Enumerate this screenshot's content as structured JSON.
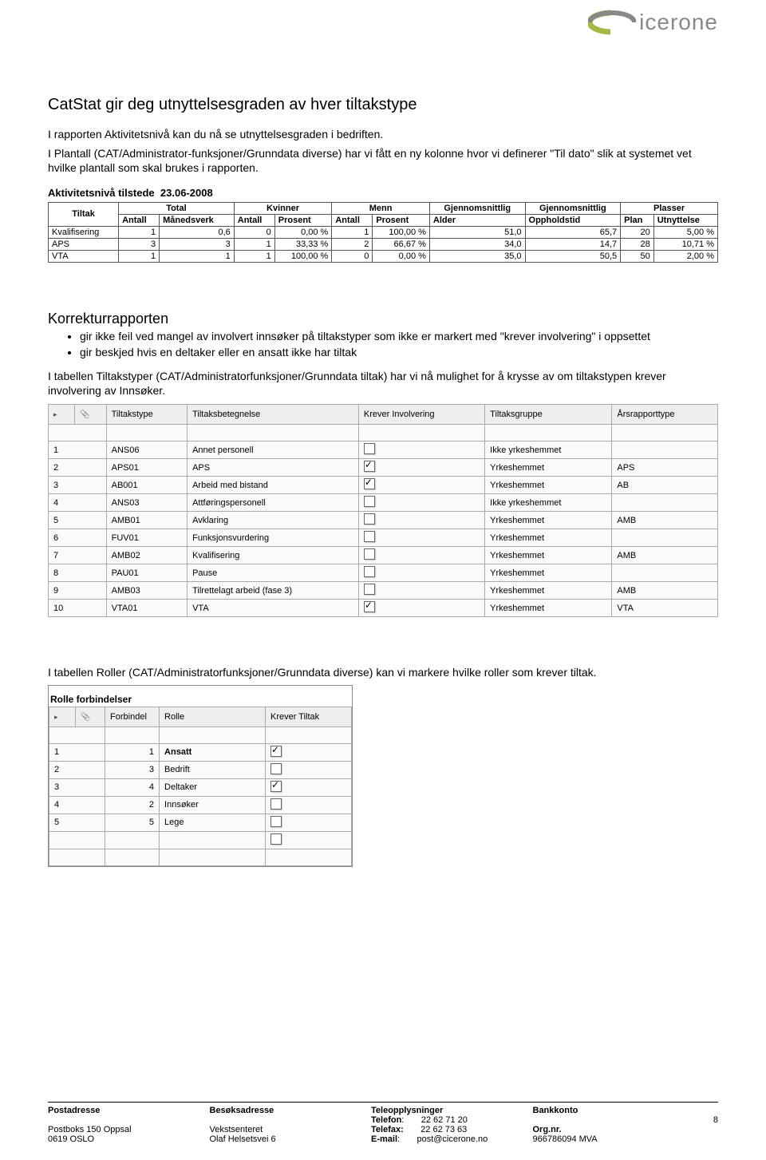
{
  "logo": {
    "text": "icerone"
  },
  "title": "CatStat gir deg utnyttelsesgraden av hver tiltakstype",
  "intro1": "I rapporten Aktivitetsnivå kan du nå se utnyttelsesgraden i bedriften.",
  "intro2": "I Plantall (CAT/Administrator-funksjoner/Grunndata diverse) har vi fått en ny kolonne hvor vi definerer \"Til dato\" slik at systemet vet hvilke plantall som skal brukes i rapporten.",
  "stats_header_label": "Aktivitetsnivå tilstede",
  "stats_header_date": "23.06-2008",
  "stats_groups": [
    "Total",
    "Kvinner",
    "Menn",
    "Gjennomsnittlig",
    "Gjennomsnittlig",
    "Plasser"
  ],
  "stats_subs": [
    "Tiltak",
    "Antall",
    "Månedsverk",
    "Antall",
    "Prosent",
    "Antall",
    "Prosent",
    "Alder",
    "Oppholdstid",
    "Plan",
    "Utnyttelse"
  ],
  "stats_rows": [
    {
      "tiltak": "Kvalifisering",
      "antall": "1",
      "mnd": "0,6",
      "kant": "0",
      "kpros": "0,00 %",
      "mant": "1",
      "mpros": "100,00 %",
      "alder": "51,0",
      "opp": "65,7",
      "plan": "20",
      "utny": "5,00 %"
    },
    {
      "tiltak": "APS",
      "antall": "3",
      "mnd": "3",
      "kant": "1",
      "kpros": "33,33 %",
      "mant": "2",
      "mpros": "66,67 %",
      "alder": "34,0",
      "opp": "14,7",
      "plan": "28",
      "utny": "10,71 %"
    },
    {
      "tiltak": "VTA",
      "antall": "1",
      "mnd": "1",
      "kant": "1",
      "kpros": "100,00 %",
      "mant": "0",
      "mpros": "0,00 %",
      "alder": "35,0",
      "opp": "50,5",
      "plan": "50",
      "utny": "2,00 %"
    }
  ],
  "korr_head": "Korrekturrapporten",
  "korr_bullets": [
    "gir ikke feil ved mangel av involvert innsøker på tiltakstyper som ikke er markert med \"krever involvering\" i oppsettet",
    "gir beskjed hvis en deltaker eller en ansatt ikke har tiltak"
  ],
  "korr_para": "I tabellen Tiltakstyper (CAT/Administratorfunksjoner/Grunndata tiltak) har vi nå mulighet for å krysse av om tiltakstypen krever involvering av Innsøker.",
  "tiltak_headers": [
    "",
    "Tiltakstype",
    "Tiltaksbetegnelse",
    "Krever Involvering",
    "Tiltaksgruppe",
    "Årsrapporttype"
  ],
  "tiltak_rows": [
    {
      "n": "1",
      "type": "ANS06",
      "bet": "Annet personell",
      "inv": false,
      "gruppe": "Ikke yrkeshemmet",
      "rapp": ""
    },
    {
      "n": "2",
      "type": "APS01",
      "bet": "APS",
      "inv": true,
      "gruppe": "Yrkeshemmet",
      "rapp": "APS"
    },
    {
      "n": "3",
      "type": "AB001",
      "bet": "Arbeid med bistand",
      "inv": true,
      "gruppe": "Yrkeshemmet",
      "rapp": "AB"
    },
    {
      "n": "4",
      "type": "ANS03",
      "bet": "Attføringspersonell",
      "inv": false,
      "gruppe": "Ikke yrkeshemmet",
      "rapp": ""
    },
    {
      "n": "5",
      "type": "AMB01",
      "bet": "Avklaring",
      "inv": false,
      "gruppe": "Yrkeshemmet",
      "rapp": "AMB"
    },
    {
      "n": "6",
      "type": "FUV01",
      "bet": "Funksjonsvurdering",
      "inv": false,
      "gruppe": "Yrkeshemmet",
      "rapp": ""
    },
    {
      "n": "7",
      "type": "AMB02",
      "bet": "Kvalifisering",
      "inv": false,
      "gruppe": "Yrkeshemmet",
      "rapp": "AMB"
    },
    {
      "n": "8",
      "type": "PAU01",
      "bet": "Pause",
      "inv": false,
      "gruppe": "Yrkeshemmet",
      "rapp": ""
    },
    {
      "n": "9",
      "type": "AMB03",
      "bet": "Tilrettelagt arbeid (fase 3)",
      "inv": false,
      "gruppe": "Yrkeshemmet",
      "rapp": "AMB"
    },
    {
      "n": "10",
      "type": "VTA01",
      "bet": "VTA",
      "inv": true,
      "gruppe": "Yrkeshemmet",
      "rapp": "VTA"
    }
  ],
  "roller_para": "I tabellen Roller (CAT/Administratorfunksjoner/Grunndata diverse) kan vi markere hvilke roller som krever tiltak.",
  "roller_title": "Rolle forbindelser",
  "roller_headers": [
    "",
    "Forbindel",
    "Rolle",
    "Krever Tiltak"
  ],
  "roller_rows": [
    {
      "n": "1",
      "forb": "1",
      "rolle": "Ansatt",
      "tiltak": true,
      "bold": true
    },
    {
      "n": "2",
      "forb": "3",
      "rolle": "Bedrift",
      "tiltak": false
    },
    {
      "n": "3",
      "forb": "4",
      "rolle": "Deltaker",
      "tiltak": true
    },
    {
      "n": "4",
      "forb": "2",
      "rolle": "Innsøker",
      "tiltak": false
    },
    {
      "n": "5",
      "forb": "5",
      "rolle": "Lege",
      "tiltak": false
    }
  ],
  "footer": {
    "post_h": "Postadresse",
    "post_1": "Postboks 150 Oppsal",
    "post_2": "0619 OSLO",
    "besok_h": "Besøksadresse",
    "besok_1": "Vekstsenteret",
    "besok_2": "Olaf Helsetsvei 6",
    "tele_h": "Teleopplysninger",
    "tele_tel_l": "Telefon",
    "tele_tel_v": "22 62 71 20",
    "tele_fax_l": "Telefax:",
    "tele_fax_v": "22 62 73 63",
    "tele_mail_l": "E-mail",
    "tele_mail_v": "post@cicerone.no",
    "bank_h": "Bankkonto",
    "bank_org_l": "Org.nr.",
    "bank_org_v": "966786094 MVA",
    "page_num": "8"
  },
  "chart_data": {
    "type": "table",
    "title": "Aktivitetsnivå tilstede 23.06-2008",
    "columns": [
      "Tiltak",
      "Antall",
      "Månedsverk",
      "Kvinner Antall",
      "Kvinner Prosent",
      "Menn Antall",
      "Menn Prosent",
      "Gjennomsnittlig Alder",
      "Gjennomsnittlig Oppholdstid",
      "Plan",
      "Utnyttelse"
    ],
    "rows": [
      [
        "Kvalifisering",
        1,
        0.6,
        0,
        "0,00 %",
        1,
        "100,00 %",
        51.0,
        65.7,
        20,
        "5,00 %"
      ],
      [
        "APS",
        3,
        3,
        1,
        "33,33 %",
        2,
        "66,67 %",
        34.0,
        14.7,
        28,
        "10,71 %"
      ],
      [
        "VTA",
        1,
        1,
        1,
        "100,00 %",
        0,
        "0,00 %",
        35.0,
        50.5,
        50,
        "2,00 %"
      ]
    ]
  }
}
